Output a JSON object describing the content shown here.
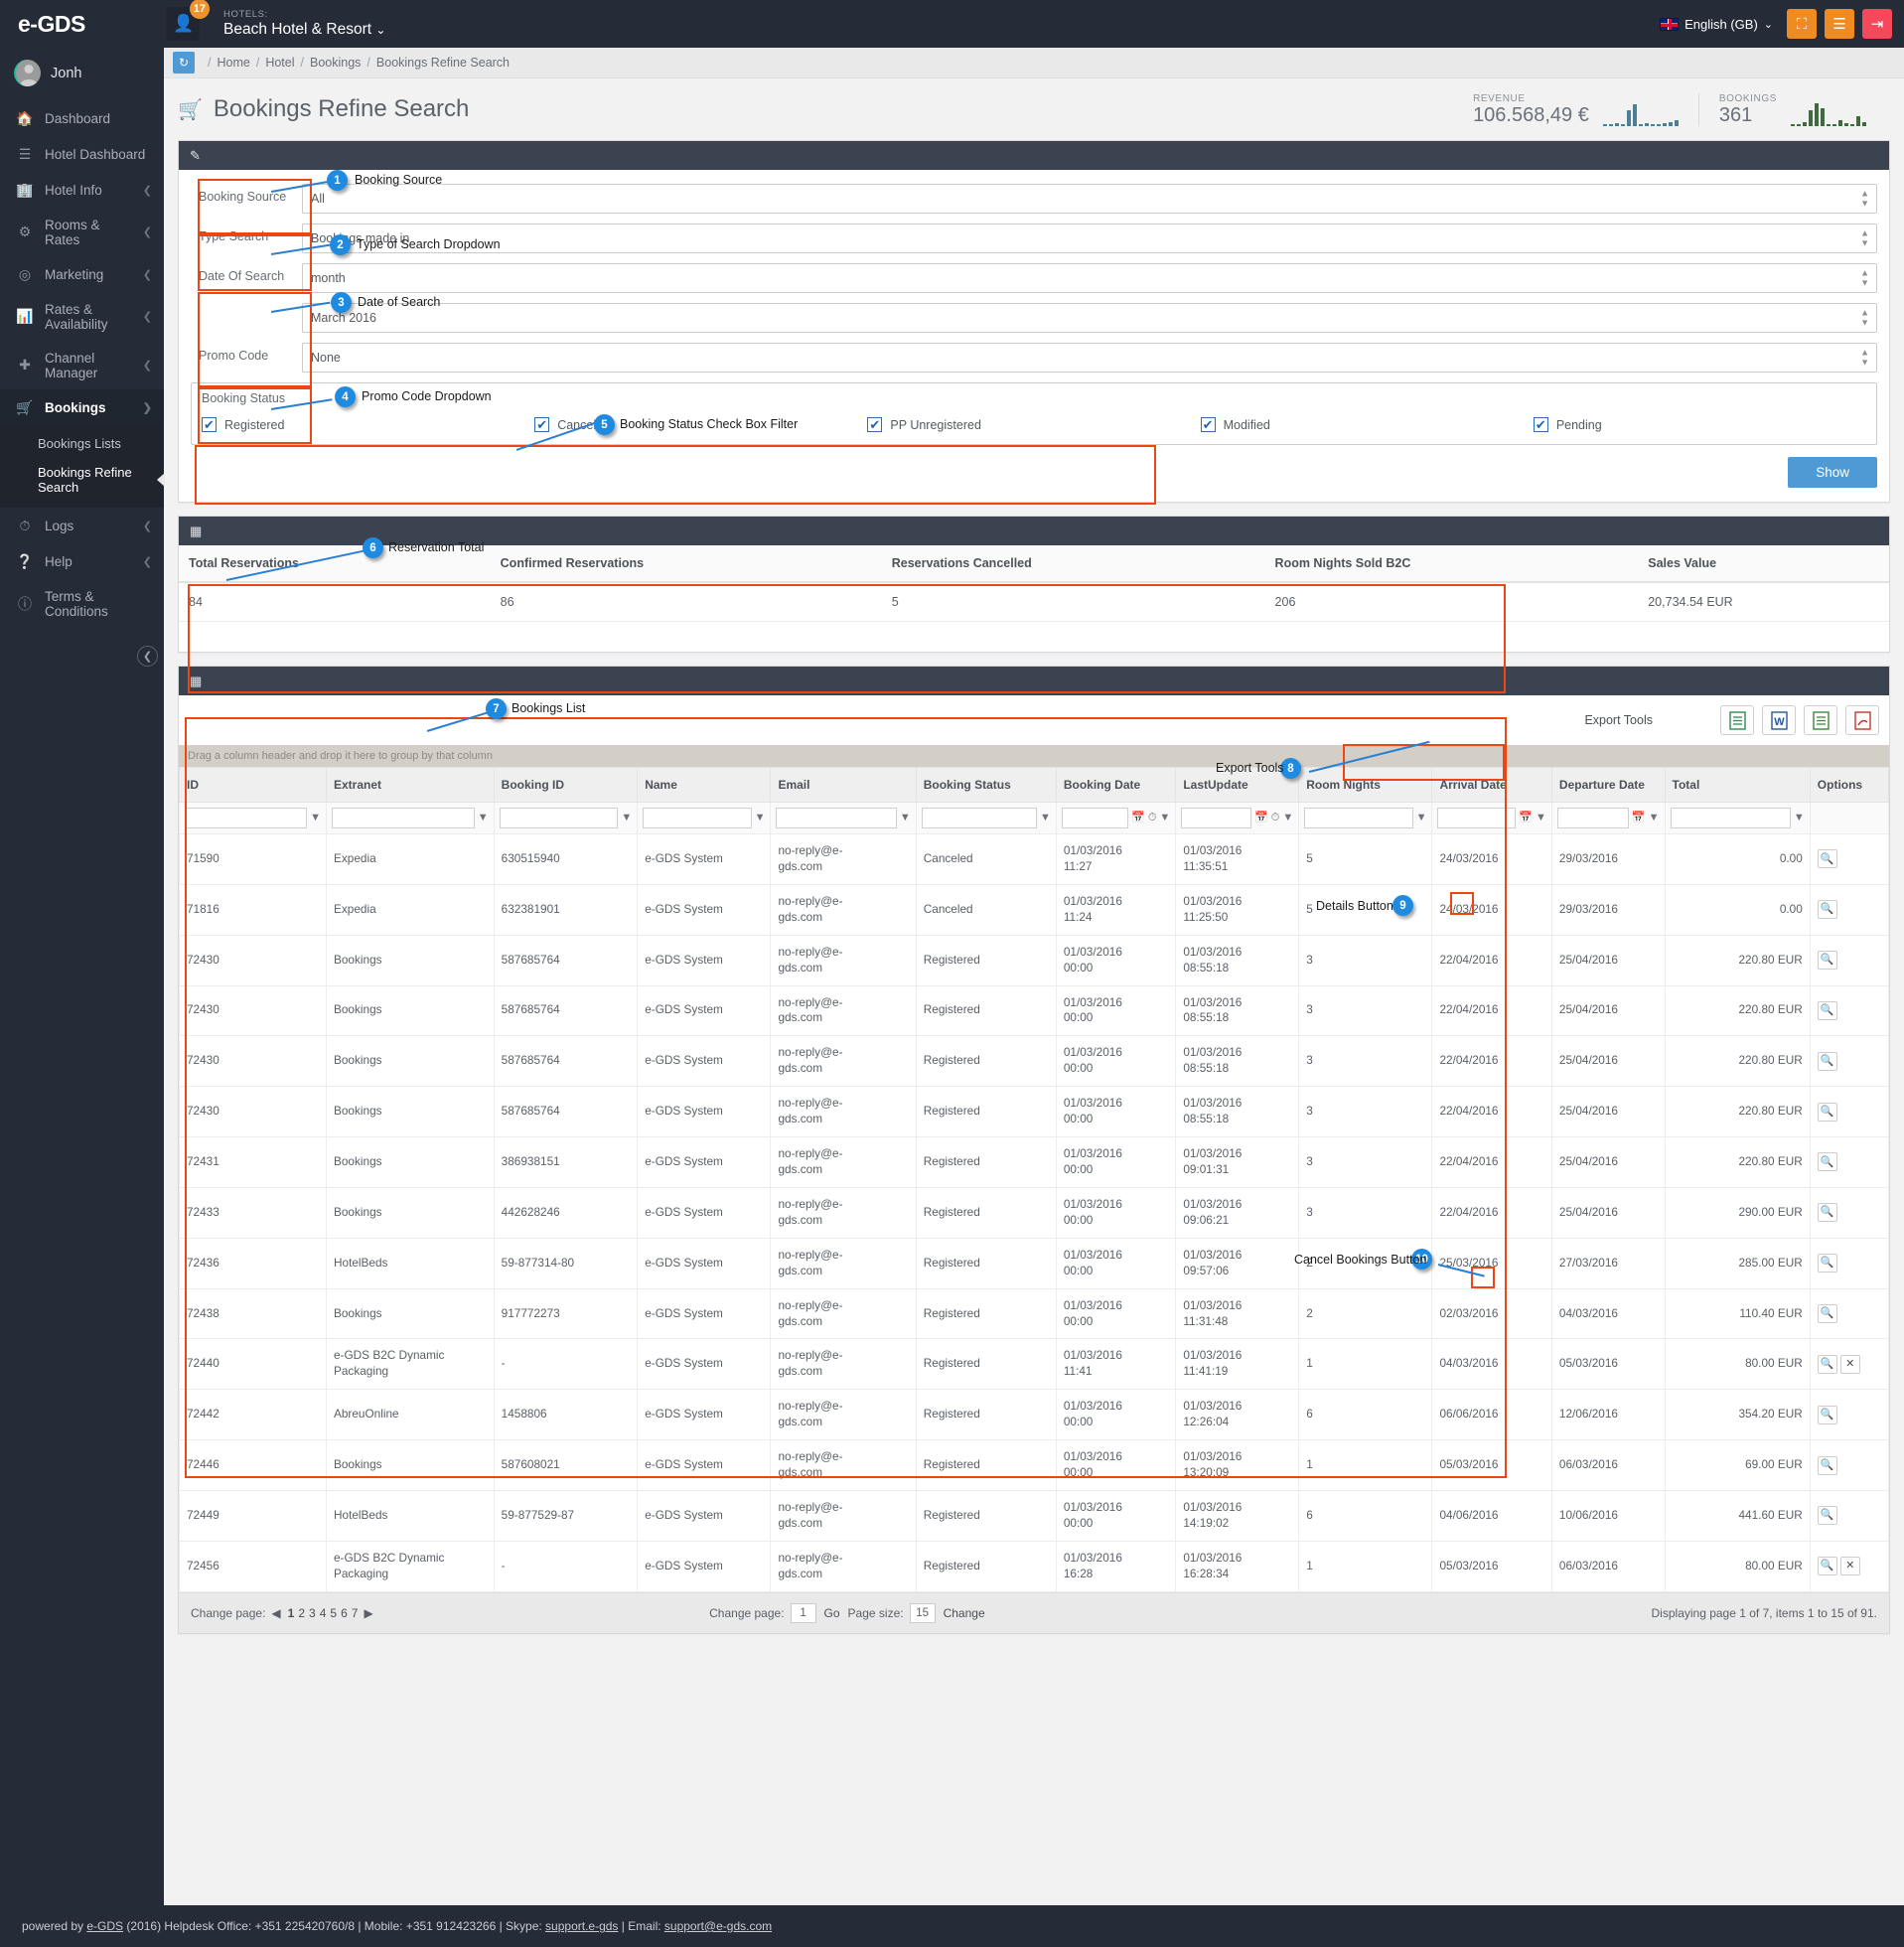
{
  "topbar": {
    "brand": "e-GDS",
    "notification_count": "17",
    "hotels_label": "HOTELS:",
    "hotel_name": "Beach Hotel & Resort",
    "language": "English (GB)",
    "fullscreen_icon": "expand-icon",
    "menu_icon": "hamburger-icon",
    "logout_icon": "logout-icon"
  },
  "sidebar": {
    "user": "Jonh",
    "items": [
      {
        "label": "Dashboard",
        "icon": "home-icon",
        "chevron": false
      },
      {
        "label": "Hotel Dashboard",
        "icon": "bars-icon",
        "chevron": false
      },
      {
        "label": "Hotel Info",
        "icon": "building-icon",
        "chevron": true
      },
      {
        "label": "Rooms & Rates",
        "icon": "cogs-icon",
        "chevron": true
      },
      {
        "label": "Marketing",
        "icon": "target-icon",
        "chevron": true
      },
      {
        "label": "Rates & Availability",
        "icon": "chart-icon",
        "chevron": true
      },
      {
        "label": "Channel Manager",
        "icon": "arrows-icon",
        "chevron": true
      },
      {
        "label": "Bookings",
        "icon": "cart-icon",
        "chevron": true,
        "active": true
      }
    ],
    "sub_items": [
      {
        "label": "Bookings Lists",
        "selected": false
      },
      {
        "label": "Bookings Refine Search",
        "selected": true
      }
    ],
    "items_after": [
      {
        "label": "Logs",
        "icon": "clock-icon",
        "chevron": true
      },
      {
        "label": "Help",
        "icon": "question-icon",
        "chevron": true
      },
      {
        "label": "Terms & Conditions",
        "icon": "info-icon",
        "chevron": false
      }
    ],
    "collapse_icon": "chevron-left-icon"
  },
  "breadcrumb": {
    "refresh_icon": "refresh-icon",
    "items": [
      "Home",
      "Hotel",
      "Bookings",
      "Bookings Refine Search"
    ]
  },
  "page": {
    "title": "Bookings Refine Search",
    "title_icon": "cart-icon"
  },
  "stats": [
    {
      "label": "REVENUE",
      "value": "106.568,49 €",
      "color": "#4a7f95",
      "spark": [
        2,
        2,
        3,
        2,
        16,
        22,
        2,
        3,
        2,
        2,
        3,
        4,
        6
      ]
    },
    {
      "label": "BOOKINGS",
      "value": "361",
      "color": "#3f6b3f",
      "spark": [
        2,
        2,
        4,
        16,
        23,
        18,
        2,
        2,
        6,
        3,
        2,
        10,
        4
      ]
    }
  ],
  "filters": {
    "panel_icon": "edit-icon",
    "booking_source": {
      "label": "Booking Source",
      "value": "All"
    },
    "type_search": {
      "label": "Type Search",
      "value": "Bookings made in"
    },
    "date_of_search": {
      "label": "Date Of Search",
      "value_period": "month",
      "value_month": "March 2016"
    },
    "promo_code": {
      "label": "Promo Code",
      "value": "None"
    },
    "booking_status": {
      "legend": "Booking Status",
      "options": [
        {
          "label": "Registered",
          "checked": true
        },
        {
          "label": "Canceled",
          "checked": true
        },
        {
          "label": "PP Unregistered",
          "checked": true
        },
        {
          "label": "Modified",
          "checked": true
        },
        {
          "label": "Pending",
          "checked": true
        }
      ]
    },
    "show_button": "Show"
  },
  "summary": {
    "panel_icon": "table-icon",
    "headers": [
      "Total Reservations",
      "Confirmed Reservations",
      "Reservations Cancelled",
      "Room Nights Sold B2C",
      "Sales Value"
    ],
    "row": [
      "84",
      "86",
      "5",
      "206",
      "20,734.54 EUR"
    ]
  },
  "bookings_list": {
    "panel_icon": "table-icon",
    "export_label": "Export Tools",
    "export_buttons": [
      {
        "name": "export-excel-icon",
        "glyph": "📄",
        "color": "#2e8b4f"
      },
      {
        "name": "export-word-icon",
        "glyph": "W",
        "color": "#2b5797"
      },
      {
        "name": "export-csv-icon",
        "glyph": "📄",
        "color": "#3b8a3b"
      },
      {
        "name": "export-pdf-icon",
        "glyph": "📕",
        "color": "#c0392b"
      }
    ],
    "drag_hint": "Drag a column header and drop it here to group by that column",
    "columns": [
      "ID",
      "Extranet",
      "Booking ID",
      "Name",
      "Email",
      "Booking Status",
      "Booking Date",
      "LastUpdate",
      "Room Nights",
      "Arrival Date",
      "Departure Date",
      "Total",
      "Options"
    ],
    "rows": [
      {
        "id": "71590",
        "extranet": "Expedia",
        "booking_id": "630515940",
        "name": "e-GDS System",
        "email": "no-reply@e-gds.com",
        "status": "Canceled",
        "booking_date": "01/03/2016 11:27",
        "last_update": "01/03/2016 11:35:51",
        "room_nights": "5",
        "arrival": "24/03/2016",
        "departure": "29/03/2016",
        "total": "0.00",
        "has_cancel": false
      },
      {
        "id": "71816",
        "extranet": "Expedia",
        "booking_id": "632381901",
        "name": "e-GDS System",
        "email": "no-reply@e-gds.com",
        "status": "Canceled",
        "booking_date": "01/03/2016 11:24",
        "last_update": "01/03/2016 11:25:50",
        "room_nights": "5",
        "arrival": "24/03/2016",
        "departure": "29/03/2016",
        "total": "0.00",
        "has_cancel": false
      },
      {
        "id": "72430",
        "extranet": "Bookings",
        "booking_id": "587685764",
        "name": "e-GDS System",
        "email": "no-reply@e-gds.com",
        "status": "Registered",
        "booking_date": "01/03/2016 00:00",
        "last_update": "01/03/2016 08:55:18",
        "room_nights": "3",
        "arrival": "22/04/2016",
        "departure": "25/04/2016",
        "total": "220.80 EUR",
        "has_cancel": false
      },
      {
        "id": "72430",
        "extranet": "Bookings",
        "booking_id": "587685764",
        "name": "e-GDS System",
        "email": "no-reply@e-gds.com",
        "status": "Registered",
        "booking_date": "01/03/2016 00:00",
        "last_update": "01/03/2016 08:55:18",
        "room_nights": "3",
        "arrival": "22/04/2016",
        "departure": "25/04/2016",
        "total": "220.80 EUR",
        "has_cancel": false
      },
      {
        "id": "72430",
        "extranet": "Bookings",
        "booking_id": "587685764",
        "name": "e-GDS System",
        "email": "no-reply@e-gds.com",
        "status": "Registered",
        "booking_date": "01/03/2016 00:00",
        "last_update": "01/03/2016 08:55:18",
        "room_nights": "3",
        "arrival": "22/04/2016",
        "departure": "25/04/2016",
        "total": "220.80 EUR",
        "has_cancel": false
      },
      {
        "id": "72430",
        "extranet": "Bookings",
        "booking_id": "587685764",
        "name": "e-GDS System",
        "email": "no-reply@e-gds.com",
        "status": "Registered",
        "booking_date": "01/03/2016 00:00",
        "last_update": "01/03/2016 08:55:18",
        "room_nights": "3",
        "arrival": "22/04/2016",
        "departure": "25/04/2016",
        "total": "220.80 EUR",
        "has_cancel": false
      },
      {
        "id": "72431",
        "extranet": "Bookings",
        "booking_id": "386938151",
        "name": "e-GDS System",
        "email": "no-reply@e-gds.com",
        "status": "Registered",
        "booking_date": "01/03/2016 00:00",
        "last_update": "01/03/2016 09:01:31",
        "room_nights": "3",
        "arrival": "22/04/2016",
        "departure": "25/04/2016",
        "total": "220.80 EUR",
        "has_cancel": false
      },
      {
        "id": "72433",
        "extranet": "Bookings",
        "booking_id": "442628246",
        "name": "e-GDS System",
        "email": "no-reply@e-gds.com",
        "status": "Registered",
        "booking_date": "01/03/2016 00:00",
        "last_update": "01/03/2016 09:06:21",
        "room_nights": "3",
        "arrival": "22/04/2016",
        "departure": "25/04/2016",
        "total": "290.00 EUR",
        "has_cancel": false
      },
      {
        "id": "72436",
        "extranet": "HotelBeds",
        "booking_id": "59-877314-80",
        "name": "e-GDS System",
        "email": "no-reply@e-gds.com",
        "status": "Registered",
        "booking_date": "01/03/2016 00:00",
        "last_update": "01/03/2016 09:57:06",
        "room_nights": "2",
        "arrival": "25/03/2016",
        "departure": "27/03/2016",
        "total": "285.00 EUR",
        "has_cancel": false
      },
      {
        "id": "72438",
        "extranet": "Bookings",
        "booking_id": "917772273",
        "name": "e-GDS System",
        "email": "no-reply@e-gds.com",
        "status": "Registered",
        "booking_date": "01/03/2016 00:00",
        "last_update": "01/03/2016 11:31:48",
        "room_nights": "2",
        "arrival": "02/03/2016",
        "departure": "04/03/2016",
        "total": "110.40 EUR",
        "has_cancel": false
      },
      {
        "id": "72440",
        "extranet": "e-GDS B2C Dynamic Packaging",
        "booking_id": "-",
        "name": "e-GDS System",
        "email": "no-reply@e-gds.com",
        "status": "Registered",
        "booking_date": "01/03/2016 11:41",
        "last_update": "01/03/2016 11:41:19",
        "room_nights": "1",
        "arrival": "04/03/2016",
        "departure": "05/03/2016",
        "total": "80.00 EUR",
        "has_cancel": true
      },
      {
        "id": "72442",
        "extranet": "AbreuOnline",
        "booking_id": "1458806",
        "name": "e-GDS System",
        "email": "no-reply@e-gds.com",
        "status": "Registered",
        "booking_date": "01/03/2016 00:00",
        "last_update": "01/03/2016 12:26:04",
        "room_nights": "6",
        "arrival": "06/06/2016",
        "departure": "12/06/2016",
        "total": "354.20 EUR",
        "has_cancel": false
      },
      {
        "id": "72446",
        "extranet": "Bookings",
        "booking_id": "587608021",
        "name": "e-GDS System",
        "email": "no-reply@e-gds.com",
        "status": "Registered",
        "booking_date": "01/03/2016 00:00",
        "last_update": "01/03/2016 13:20:09",
        "room_nights": "1",
        "arrival": "05/03/2016",
        "departure": "06/03/2016",
        "total": "69.00 EUR",
        "has_cancel": false
      },
      {
        "id": "72449",
        "extranet": "HotelBeds",
        "booking_id": "59-877529-87",
        "name": "e-GDS System",
        "email": "no-reply@e-gds.com",
        "status": "Registered",
        "booking_date": "01/03/2016 00:00",
        "last_update": "01/03/2016 14:19:02",
        "room_nights": "6",
        "arrival": "04/06/2016",
        "departure": "10/06/2016",
        "total": "441.60 EUR",
        "has_cancel": false
      },
      {
        "id": "72456",
        "extranet": "e-GDS B2C Dynamic Packaging",
        "booking_id": "-",
        "name": "e-GDS System",
        "email": "no-reply@e-gds.com",
        "status": "Registered",
        "booking_date": "01/03/2016 16:28",
        "last_update": "01/03/2016 16:28:34",
        "room_nights": "1",
        "arrival": "05/03/2016",
        "departure": "06/03/2016",
        "total": "80.00 EUR",
        "has_cancel": true
      }
    ]
  },
  "pager": {
    "change_page_label": "Change page:",
    "prev_icon": "caret-left-icon",
    "next_icon": "caret-right-icon",
    "pages": [
      "1",
      "2",
      "3",
      "4",
      "5",
      "6",
      "7"
    ],
    "current_page": "1",
    "goto_label": "Change page:",
    "goto_value": "1",
    "go_label": "Go",
    "page_size_label": "Page size:",
    "page_size_value": "15",
    "change_label": "Change",
    "status": "Displaying page 1 of 7, items 1 to 15 of 91."
  },
  "footer": {
    "prefix": "powered by ",
    "brand": "e-GDS",
    "mid": " (2016) Helpdesk Office: +351 225420760/8  |  Mobile: +351 912423266  |  Skype: ",
    "skype": "support.e-gds",
    "email_label": "  |  Email: ",
    "email": "support@e-gds.com"
  },
  "annotations": [
    {
      "n": "1",
      "label": "Booking Source"
    },
    {
      "n": "2",
      "label": "Type of Search Dropdown"
    },
    {
      "n": "3",
      "label": "Date of Search"
    },
    {
      "n": "4",
      "label": "Promo Code Dropdown"
    },
    {
      "n": "5",
      "label": "Booking Status Check Box Filter"
    },
    {
      "n": "6",
      "label": "Reservation Total"
    },
    {
      "n": "7",
      "label": "Bookings List"
    },
    {
      "n": "8",
      "label": "Export Tools"
    },
    {
      "n": "9",
      "label": "Details Button"
    },
    {
      "n": "10",
      "label": "Cancel Bookings Button"
    }
  ]
}
